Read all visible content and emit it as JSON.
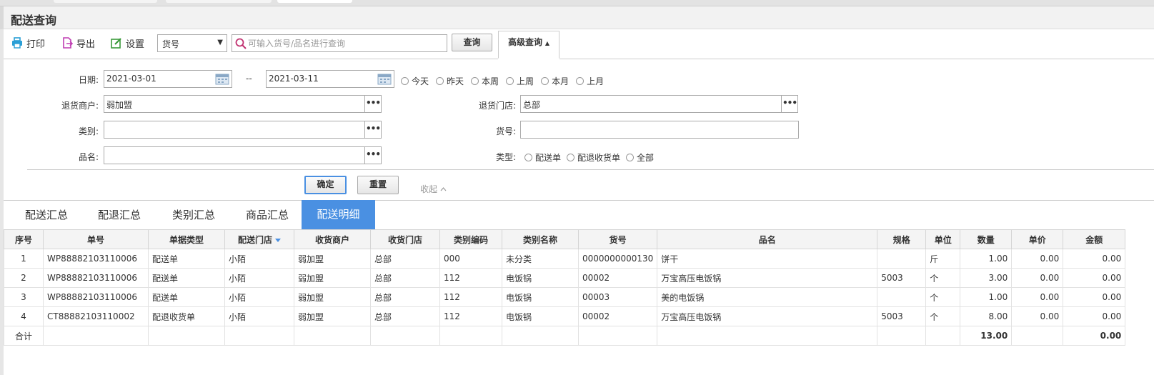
{
  "title": "配送查询",
  "toolbar": {
    "print": "打印",
    "export": "导出",
    "settings": "设置",
    "select_value": "货号",
    "search_placeholder": "可输入货号/品名进行查询",
    "query": "查询",
    "advanced": "高级查询"
  },
  "form": {
    "date_label": "日期:",
    "date_from": "2021-03-01",
    "date_sep": "--",
    "date_to": "2021-03-11",
    "quick_dates": [
      "今天",
      "昨天",
      "本周",
      "上周",
      "本月",
      "上月"
    ],
    "merchant_label": "退货商户:",
    "merchant_value": "弱加盟",
    "store_label": "退货门店:",
    "store_value": "总部",
    "category_label": "类别:",
    "category_value": "",
    "sku_label": "货号:",
    "sku_value": "",
    "name_label": "品名:",
    "name_value": "",
    "type_label": "类型:",
    "types": [
      "配送单",
      "配退收货单",
      "全部"
    ],
    "confirm": "确定",
    "reset": "重置",
    "collapse": "收起"
  },
  "tabs": [
    "配送汇总",
    "配退汇总",
    "类别汇总",
    "商品汇总",
    "配送明细"
  ],
  "active_tab": 4,
  "colors": {
    "accent": "#4a90e2",
    "print_icon": "#2a9fd6",
    "export_icon": "#c03fb3",
    "settings_icon": "#3a9a3a",
    "search_icon": "#c0306f"
  },
  "table": {
    "headers": [
      "序号",
      "单号",
      "单据类型",
      "配送门店",
      "收货商户",
      "收货门店",
      "类别编码",
      "类别名称",
      "货号",
      "品名",
      "规格",
      "单位",
      "数量",
      "单价",
      "金额"
    ],
    "rows": [
      [
        "1",
        "WP88882103110006",
        "配送单",
        "小陌",
        "弱加盟",
        "总部",
        "000",
        "未分类",
        "0000000000130",
        "饼干",
        "",
        "斤",
        "1.00",
        "0.00",
        "0.00"
      ],
      [
        "2",
        "WP88882103110006",
        "配送单",
        "小陌",
        "弱加盟",
        "总部",
        "112",
        "电饭锅",
        "00002",
        "万宝高压电饭锅",
        "5003",
        "个",
        "3.00",
        "0.00",
        "0.00"
      ],
      [
        "3",
        "WP88882103110006",
        "配送单",
        "小陌",
        "弱加盟",
        "总部",
        "112",
        "电饭锅",
        "00003",
        "美的电饭锅",
        "",
        "个",
        "1.00",
        "0.00",
        "0.00"
      ],
      [
        "4",
        "CT88882103110002",
        "配退收货单",
        "小陌",
        "弱加盟",
        "总部",
        "112",
        "电饭锅",
        "00002",
        "万宝高压电饭锅",
        "5003",
        "个",
        "8.00",
        "0.00",
        "0.00"
      ]
    ],
    "footer": [
      "合计",
      "",
      "",
      "",
      "",
      "",
      "",
      "",
      "",
      "",
      "",
      "",
      "13.00",
      "",
      "0.00"
    ]
  }
}
